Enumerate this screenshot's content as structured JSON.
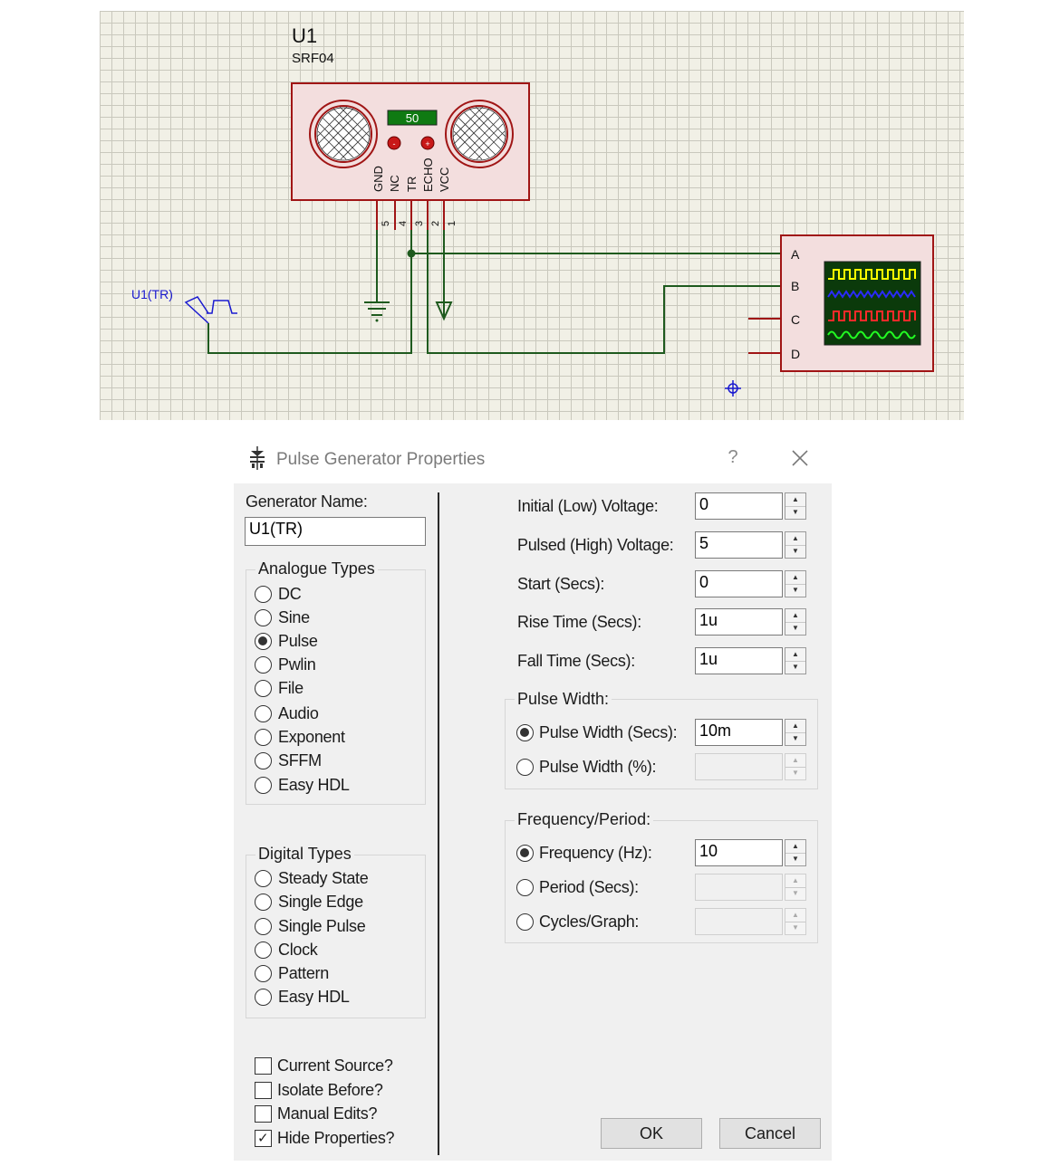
{
  "schematic": {
    "component_ref": "U1",
    "component_part": "SRF04",
    "display_value": "50",
    "pin_names": [
      "GND",
      "NC",
      "TR",
      "ECHO",
      "VCC"
    ],
    "pin_numbers": [
      "5",
      "4",
      "3",
      "2",
      "1"
    ],
    "generator_label": "U1(TR)",
    "scope_channels": [
      "A",
      "B",
      "C",
      "D"
    ],
    "colors": {
      "wire": "#1e5a1e",
      "pin": "#a01515",
      "body": "#f3dede",
      "body_border": "#a01515",
      "label_blue": "#1a1ad0"
    }
  },
  "dialog": {
    "title": "Pulse Generator Properties",
    "help": "?",
    "generator_name_label": "Generator Name:",
    "generator_name_value": "U1(TR)",
    "analogue_title": "Analogue Types",
    "analogue_types": [
      {
        "label": "DC",
        "checked": false
      },
      {
        "label": "Sine",
        "checked": false
      },
      {
        "label": "Pulse",
        "checked": true
      },
      {
        "label": "Pwlin",
        "checked": false
      },
      {
        "label": "File",
        "checked": false
      },
      {
        "label": "Audio",
        "checked": false
      },
      {
        "label": "Exponent",
        "checked": false
      },
      {
        "label": "SFFM",
        "checked": false
      },
      {
        "label": "Easy HDL",
        "checked": false
      }
    ],
    "digital_title": "Digital Types",
    "digital_types": [
      {
        "label": "Steady State",
        "checked": false
      },
      {
        "label": "Single Edge",
        "checked": false
      },
      {
        "label": "Single Pulse",
        "checked": false
      },
      {
        "label": "Clock",
        "checked": false
      },
      {
        "label": "Pattern",
        "checked": false
      },
      {
        "label": "Easy HDL",
        "checked": false
      }
    ],
    "checkboxes": [
      {
        "label": "Current Source?",
        "checked": false
      },
      {
        "label": "Isolate Before?",
        "checked": false
      },
      {
        "label": "Manual Edits?",
        "checked": false
      },
      {
        "label": "Hide Properties?",
        "checked": true
      }
    ],
    "fields": [
      {
        "label": "Initial (Low) Voltage:",
        "value": "0"
      },
      {
        "label": "Pulsed (High) Voltage:",
        "value": "5"
      },
      {
        "label": "Start (Secs):",
        "value": "0"
      },
      {
        "label": "Rise Time (Secs):",
        "value": "1u"
      },
      {
        "label": "Fall Time (Secs):",
        "value": "1u"
      }
    ],
    "pulse_width": {
      "title": "Pulse Width:",
      "options": [
        {
          "label": "Pulse Width (Secs):",
          "value": "10m",
          "checked": true
        },
        {
          "label": "Pulse Width (%):",
          "value": "",
          "checked": false
        }
      ]
    },
    "freq_period": {
      "title": "Frequency/Period:",
      "options": [
        {
          "label": "Frequency (Hz):",
          "value": "10",
          "checked": true
        },
        {
          "label": "Period (Secs):",
          "value": "",
          "checked": false
        },
        {
          "label": "Cycles/Graph:",
          "value": "",
          "checked": false
        }
      ]
    },
    "ok_label": "OK",
    "cancel_label": "Cancel"
  }
}
